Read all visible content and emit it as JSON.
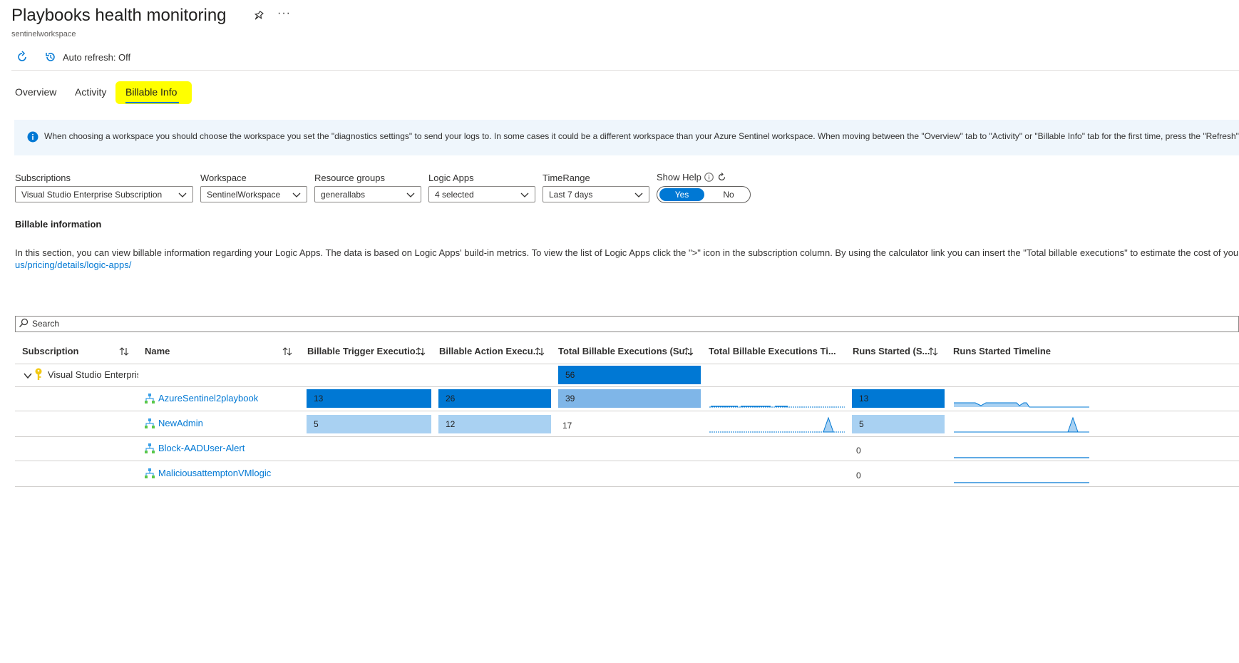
{
  "header": {
    "title": "Playbooks health monitoring",
    "subtitle": "sentinelworkspace",
    "more_label": "···"
  },
  "toolbar": {
    "auto_refresh_label": "Auto refresh: Off"
  },
  "tabs": [
    {
      "label": "Overview",
      "active": false
    },
    {
      "label": "Activity",
      "active": false
    },
    {
      "label": "Billable Info",
      "active": true
    }
  ],
  "banner": {
    "text": "When choosing a workspace you should choose the workspace you set the \"diagnostics settings\" to send your logs to. In some cases it could be a different workspace than your Azure Sentinel workspace. When moving between the \"Overview\" tab to \"Activity\" or \"Billable Info\" tab for the first time, press the \"Refresh\""
  },
  "parameters": [
    {
      "label": "Subscriptions",
      "value": "Visual Studio Enterprise Subscription"
    },
    {
      "label": "Workspace",
      "value": "SentinelWorkspace"
    },
    {
      "label": "Resource groups",
      "value": "generallabs"
    },
    {
      "label": "Logic Apps",
      "value": "4 selected"
    },
    {
      "label": "TimeRange",
      "value": "Last 7 days"
    }
  ],
  "show_help": {
    "label": "Show Help",
    "yes": "Yes",
    "no": "No",
    "selected": "Yes"
  },
  "section": {
    "title": "Billable information",
    "description": "In this section, you can view billable information regarding your Logic Apps. The data is based on Logic Apps' build-in metrics. To view the list of Logic Apps click the \">\" icon in the subscription column. By using the calculator link you can insert the \"Total billable executions\" to estimate the cost of you",
    "link": "us/pricing/details/logic-apps/"
  },
  "search": {
    "placeholder": "Search"
  },
  "table": {
    "headers": [
      "Subscription",
      "Name",
      "Billable Trigger Executio...",
      "Billable Action Execu...",
      "Total Billable Executions (Su...",
      "Total Billable Executions Ti...",
      "Runs Started (S...",
      "Runs Started Timeline"
    ],
    "group_row": {
      "subscription": "Visual Studio Enterpris",
      "total": "56"
    },
    "rows": [
      {
        "name": "AzureSentinel2playbook",
        "trigger": "13",
        "action": "26",
        "total": "39",
        "runs": "13"
      },
      {
        "name": "NewAdmin",
        "trigger": "5",
        "action": "12",
        "total": "17",
        "runs": "5"
      },
      {
        "name": "Block-AADUser-Alert",
        "trigger": "",
        "action": "",
        "total": "",
        "runs": "0"
      },
      {
        "name": "MaliciousattemptonVMlogic",
        "trigger": "",
        "action": "",
        "total": "",
        "runs": "0"
      }
    ]
  }
}
